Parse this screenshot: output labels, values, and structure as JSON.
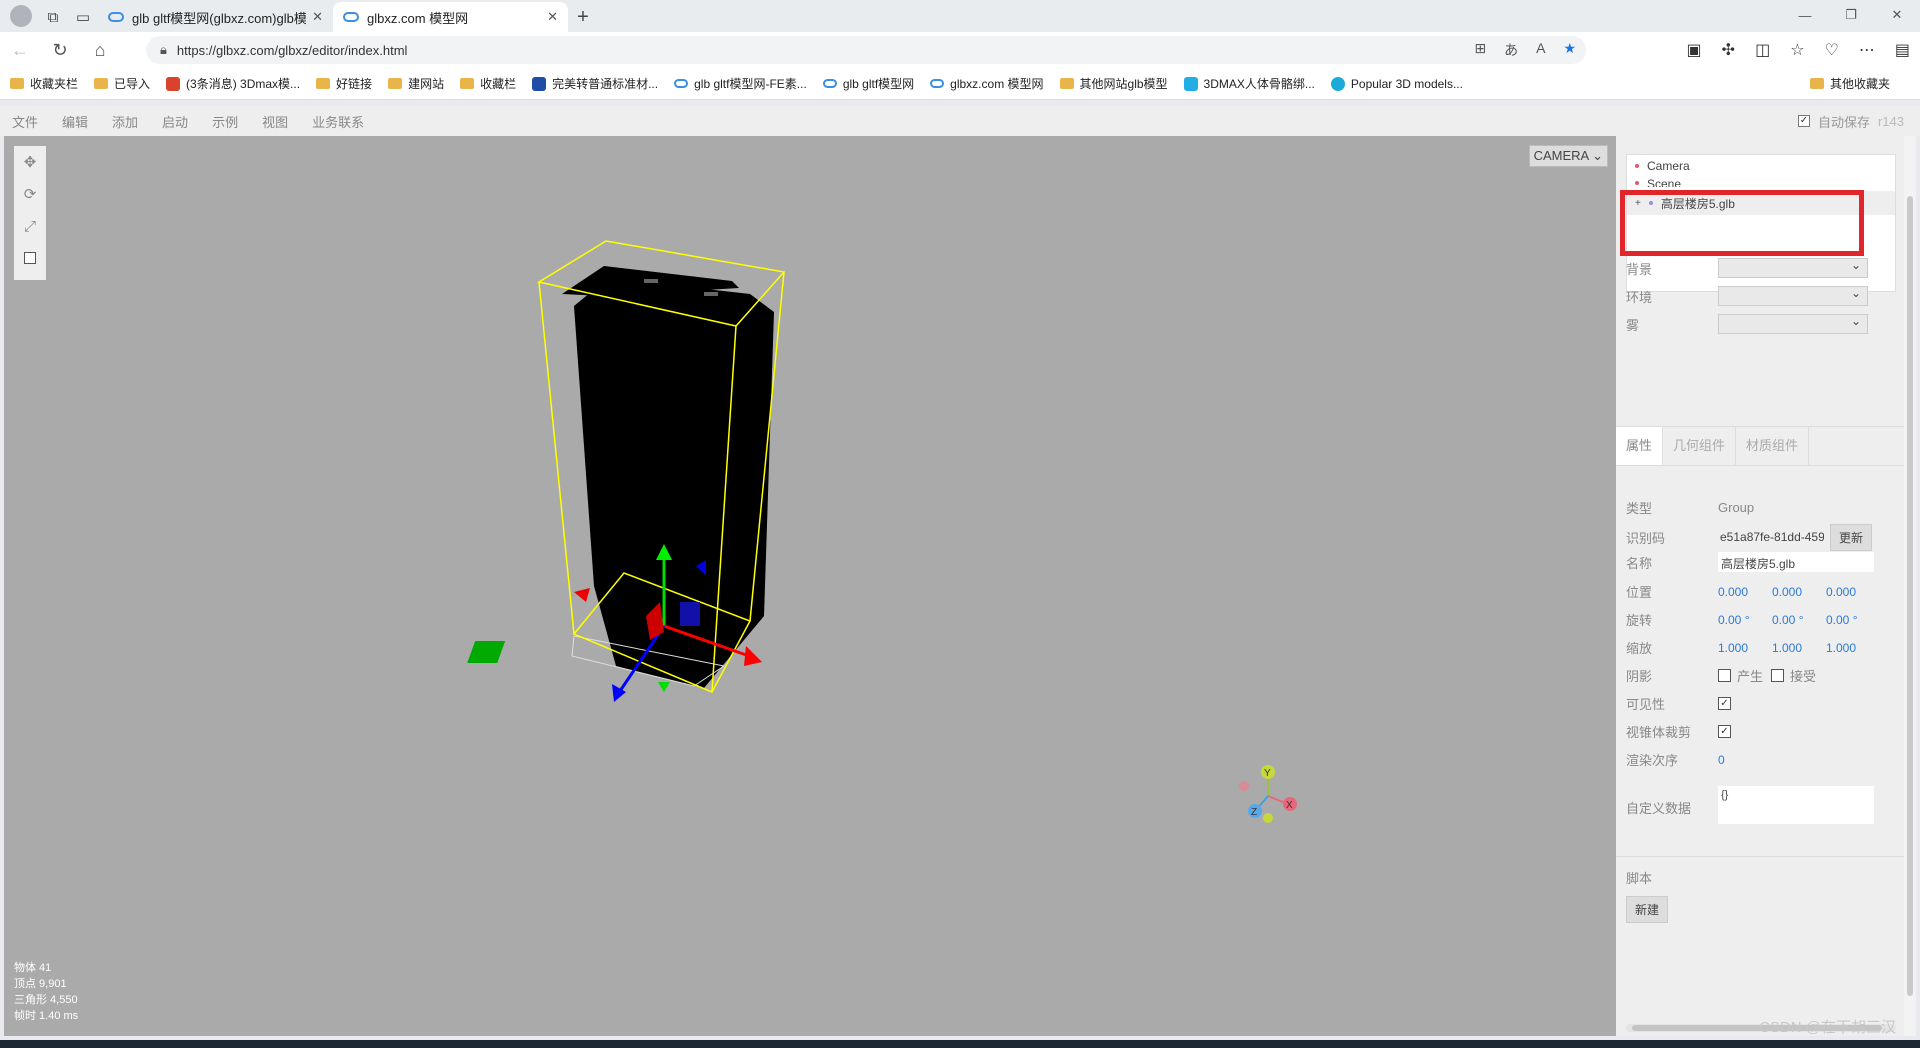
{
  "browser": {
    "tabs": [
      {
        "title": "glb gltf模型网(glbxz.com)glb模型",
        "active": false
      },
      {
        "title": "glbxz.com 模型网",
        "active": true
      }
    ],
    "url": "https://glbxz.com/glbxz/editor/index.html",
    "bookmarks": [
      {
        "label": "收藏夹栏",
        "icon": "folder-icon"
      },
      {
        "label": "已导入",
        "icon": "folder-icon"
      },
      {
        "label": "(3条消息) 3Dmax模...",
        "icon": "csdn-icon"
      },
      {
        "label": "好链接",
        "icon": "folder-icon"
      },
      {
        "label": "建网站",
        "icon": "folder-icon"
      },
      {
        "label": "收藏栏",
        "icon": "folder-icon"
      },
      {
        "label": "完美转普通标准材...",
        "icon": "tk-icon"
      },
      {
        "label": "glb gltf模型网-FE素...",
        "icon": "cloud-icon"
      },
      {
        "label": "glb gltf模型网",
        "icon": "cloud-icon"
      },
      {
        "label": "glbxz.com 模型网",
        "icon": "cloud-icon"
      },
      {
        "label": "其他网站glb模型",
        "icon": "folder-icon"
      },
      {
        "label": "3DMAX人体骨骼绑...",
        "icon": "bilibili-icon"
      },
      {
        "label": "Popular 3D models...",
        "icon": "sketchfab-icon"
      }
    ],
    "other_bookmarks": "其他收藏夹"
  },
  "menubar": {
    "items": [
      "文件",
      "编辑",
      "添加",
      "启动",
      "示例",
      "视图",
      "业务联系"
    ],
    "autosave": "自动保存",
    "version": "r143"
  },
  "viewport": {
    "camera_select": "CAMERA",
    "info": {
      "objects": "物体  41",
      "vertices": "顶点  9,901",
      "triangles": "三角形  4,550",
      "frametime": "帧时  1.40 ms"
    },
    "axes": {
      "y": "Y",
      "x": "X",
      "z": "Z"
    }
  },
  "sidebar": {
    "outliner": [
      {
        "label": "Camera",
        "color": "#e05a6a"
      },
      {
        "label": "Scene",
        "color": "#e05a6a"
      },
      {
        "label": "高层楼房5.glb",
        "color": "#a08ae0"
      }
    ],
    "scene_props": [
      {
        "label": "背景"
      },
      {
        "label": "环境"
      },
      {
        "label": "雾"
      }
    ],
    "tabs": [
      "属性",
      "几何组件",
      "材质组件"
    ],
    "props": {
      "type_label": "类型",
      "type_value": "Group",
      "uuid_label": "识别码",
      "uuid_value": "e51a87fe-81dd-459",
      "uuid_button": "更新",
      "name_label": "名称",
      "name_value": "高层楼房5.glb",
      "position_label": "位置",
      "position": [
        "0.000",
        "0.000",
        "0.000"
      ],
      "rotation_label": "旋转",
      "rotation": [
        "0.00 °",
        "0.00 °",
        "0.00 °"
      ],
      "scale_label": "缩放",
      "scale": [
        "1.000",
        "1.000",
        "1.000"
      ],
      "shadow_label": "阴影",
      "shadow_cast": "产生",
      "shadow_receive": "接受",
      "visible_label": "可见性",
      "frustum_label": "视锥体裁剪",
      "render_order_label": "渲染次序",
      "render_order": "0",
      "userdata_label": "自定义数据",
      "userdata": "{}"
    },
    "script_label": "脚本",
    "script_new": "新建"
  },
  "watermark": "CSDN @在下胡三汉"
}
